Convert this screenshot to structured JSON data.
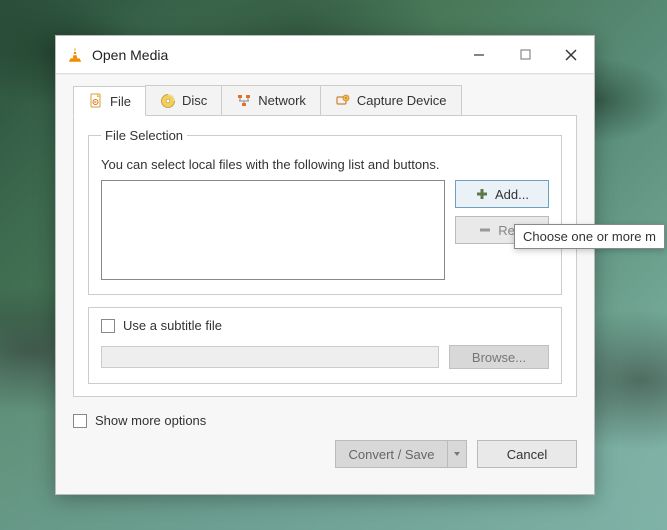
{
  "window": {
    "title": "Open Media"
  },
  "tabs": {
    "file": "File",
    "disc": "Disc",
    "network": "Network",
    "capture": "Capture Device"
  },
  "file_panel": {
    "legend": "File Selection",
    "hint": "You can select local files with the following list and buttons.",
    "add_label": "Add...",
    "remove_label": "Rem",
    "subtitle_checkbox": "Use a subtitle file",
    "browse_label": "Browse..."
  },
  "options": {
    "show_more": "Show more options"
  },
  "footer": {
    "convert_save": "Convert / Save",
    "cancel": "Cancel"
  },
  "tooltip": {
    "text": "Choose one or more m"
  },
  "icons": {
    "vlc": "vlc-cone-icon",
    "file": "file-icon",
    "disc": "disc-icon",
    "network": "network-icon",
    "capture": "capture-icon",
    "plus": "plus-icon",
    "minus": "minus-icon",
    "dropdown": "chevron-down-icon"
  }
}
